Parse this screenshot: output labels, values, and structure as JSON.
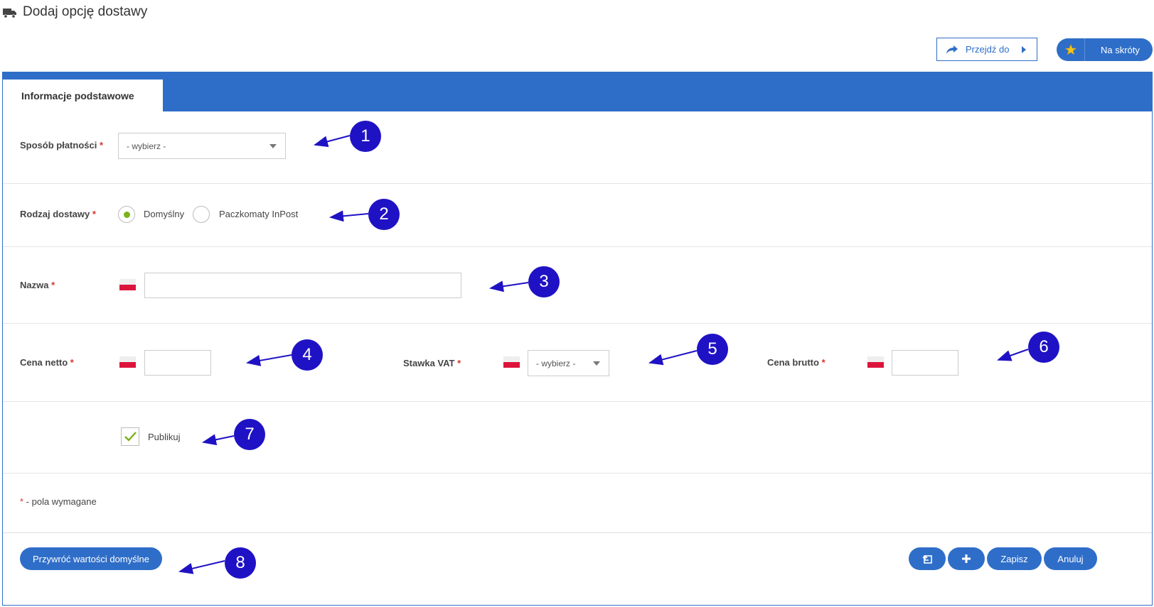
{
  "page": {
    "title": "Dodaj opcję dostawy",
    "icon": "truck-icon"
  },
  "toolbar": {
    "goto_label": "Przejdź do",
    "shortcut_label": "Na skróty"
  },
  "tabs": [
    {
      "label": "Informacje podstawowe",
      "active": true
    }
  ],
  "form": {
    "payment_method": {
      "label": "Sposób płatności",
      "required_mark": "*",
      "value": "- wybierz -"
    },
    "delivery_type": {
      "label": "Rodzaj dostawy",
      "required_mark": "*",
      "options": [
        {
          "label": "Domyślny",
          "selected": true
        },
        {
          "label": "Paczkomaty InPost",
          "selected": false
        }
      ]
    },
    "name": {
      "label": "Nazwa",
      "required_mark": "*",
      "value": ""
    },
    "net_price": {
      "label": "Cena netto",
      "required_mark": "*",
      "value": ""
    },
    "vat_rate": {
      "label": "Stawka VAT",
      "required_mark": "*",
      "value": "- wybierz -"
    },
    "gross_price": {
      "label": "Cena brutto",
      "required_mark": "*",
      "value": ""
    },
    "publish": {
      "label": "Publikuj",
      "checked": true
    },
    "legend": {
      "mark": "*",
      "text": " - pola wymagane"
    }
  },
  "footer": {
    "restore_label": "Przywróć wartości domyślne",
    "save_label": "Zapisz",
    "cancel_label": "Anuluj"
  },
  "callouts": [
    "1",
    "2",
    "3",
    "4",
    "5",
    "6",
    "7",
    "8"
  ],
  "colors": {
    "primary": "#2f6ec8",
    "callout": "#1f12c4",
    "required": "#d9342b",
    "radio_selected": "#7ab317",
    "check": "#7ab317"
  }
}
